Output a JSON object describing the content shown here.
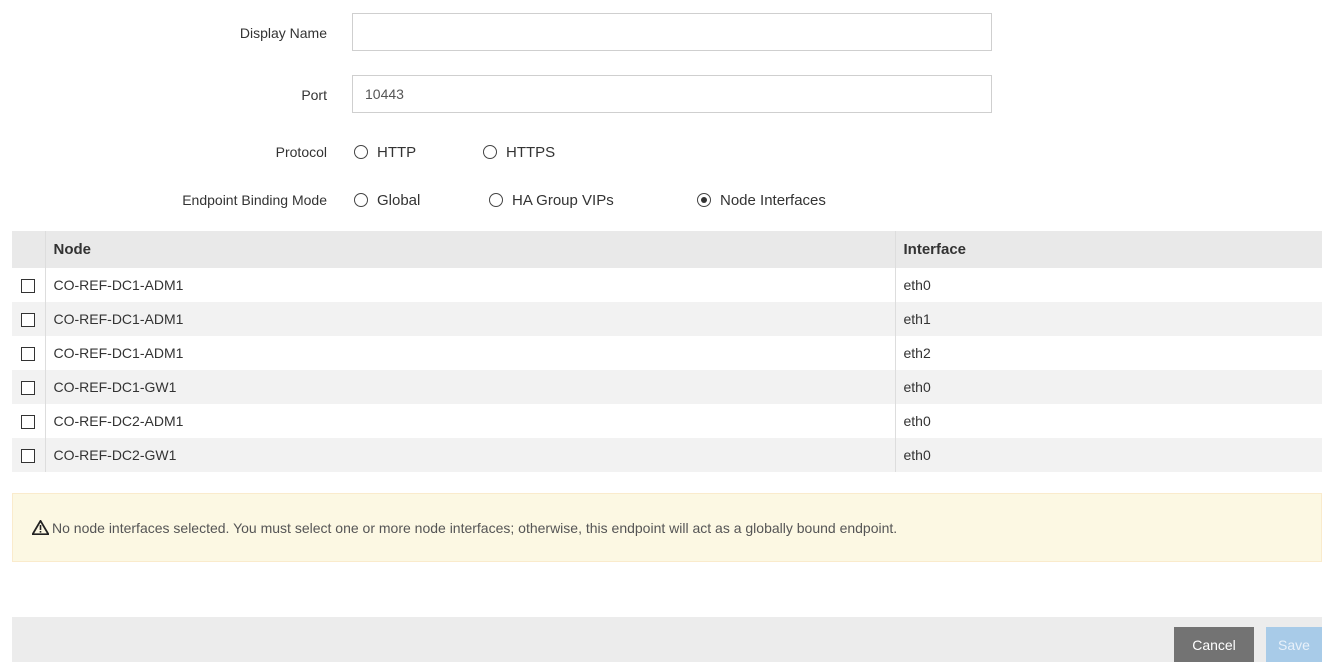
{
  "form": {
    "display_name_label": "Display Name",
    "display_name_value": "",
    "port_label": "Port",
    "port_value": "10443",
    "protocol_label": "Protocol",
    "protocol_options": [
      {
        "label": "HTTP",
        "checked": false
      },
      {
        "label": "HTTPS",
        "checked": false
      }
    ],
    "binding_label": "Endpoint Binding Mode",
    "binding_options": [
      {
        "label": "Global",
        "checked": false
      },
      {
        "label": "HA Group VIPs",
        "checked": false
      },
      {
        "label": "Node Interfaces",
        "checked": true
      }
    ]
  },
  "table": {
    "headers": {
      "node": "Node",
      "interface": "Interface"
    },
    "rows": [
      {
        "node": "CO-REF-DC1-ADM1",
        "interface": "eth0",
        "checked": false
      },
      {
        "node": "CO-REF-DC1-ADM1",
        "interface": "eth1",
        "checked": false
      },
      {
        "node": "CO-REF-DC1-ADM1",
        "interface": "eth2",
        "checked": false
      },
      {
        "node": "CO-REF-DC1-GW1",
        "interface": "eth0",
        "checked": false
      },
      {
        "node": "CO-REF-DC2-ADM1",
        "interface": "eth0",
        "checked": false
      },
      {
        "node": "CO-REF-DC2-GW1",
        "interface": "eth0",
        "checked": false
      }
    ]
  },
  "warning": {
    "icon": "warning-triangle-icon",
    "text": "No node interfaces selected. You must select one or more node interfaces; otherwise, this endpoint will act as a globally bound endpoint."
  },
  "footer": {
    "cancel_label": "Cancel",
    "save_label": "Save"
  }
}
